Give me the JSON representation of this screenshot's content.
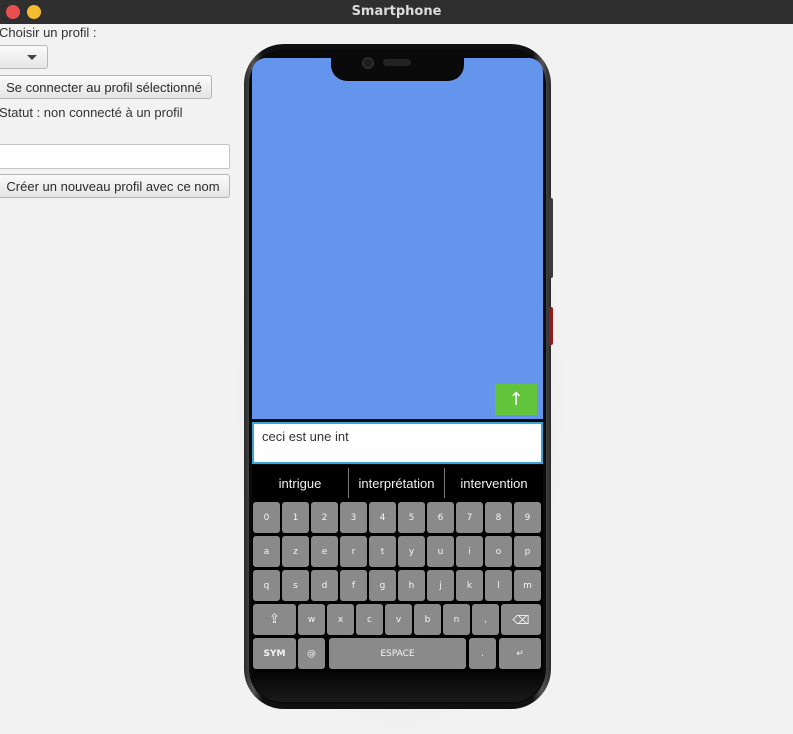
{
  "window": {
    "title": "Smartphone"
  },
  "profile": {
    "choose_label": "Choisir un profil :",
    "connect_button": "Se connecter au profil sélectionné",
    "status": "Statut : non connecté à un profil",
    "new_name_value": "",
    "create_button": "Créer un nouveau profil avec ce nom"
  },
  "phone": {
    "send_icon": "↑",
    "message": "ceci est une int",
    "suggestions": [
      "intrigue",
      "interprétation",
      "intervention"
    ],
    "keyboard": {
      "row1": [
        "0",
        "1",
        "2",
        "3",
        "4",
        "5",
        "6",
        "7",
        "8",
        "9"
      ],
      "row2": [
        "a",
        "z",
        "e",
        "r",
        "t",
        "y",
        "u",
        "i",
        "o",
        "p"
      ],
      "row3": [
        "q",
        "s",
        "d",
        "f",
        "g",
        "h",
        "j",
        "k",
        "l",
        "m"
      ],
      "row4": [
        "⇪",
        "w",
        "x",
        "c",
        "v",
        "b",
        "n",
        ",",
        "⌫"
      ],
      "row5": [
        "SYM",
        "@",
        "ESPACE",
        ".",
        "↵"
      ]
    }
  },
  "colors": {
    "screen": "#6495ed",
    "send": "#62c43a",
    "input_border": "#3ca3d8"
  }
}
